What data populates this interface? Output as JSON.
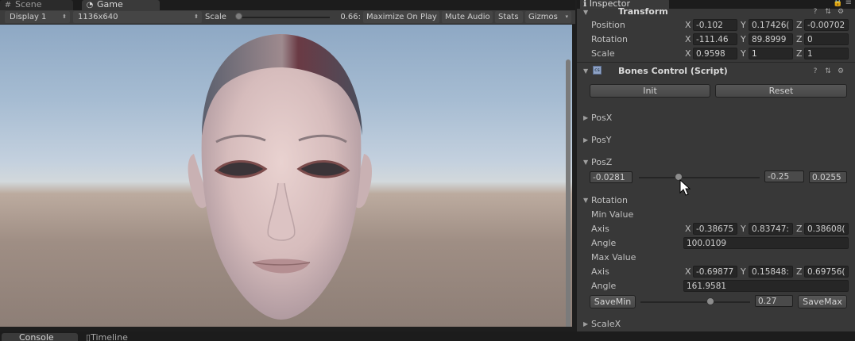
{
  "tabs": {
    "scene": "Scene",
    "game": "Game",
    "console": "Console",
    "timeline": "Timeline"
  },
  "game_toolbar": {
    "display": "Display 1",
    "resolution": "1136x640",
    "scale_label": "Scale",
    "scale_value": "0.66:",
    "maximize": "Maximize On Play",
    "mute": "Mute Audio",
    "stats": "Stats",
    "gizmos": "Gizmos"
  },
  "inspector": {
    "tab": "Inspector",
    "transform": {
      "title": "Transform",
      "position_label": "Position",
      "position": {
        "x": "-0.102",
        "y": "0.17426(",
        "z": "-0.00702"
      },
      "rotation_label": "Rotation",
      "rotation": {
        "x": "-111.46",
        "y": "89.8999",
        "z": "0"
      },
      "scale_label": "Scale",
      "scale": {
        "x": "0.9598",
        "y": "1",
        "z": "1"
      }
    },
    "axis_labels": {
      "x": "X",
      "y": "Y",
      "z": "Z"
    },
    "bones": {
      "title": "Bones Control (Script)",
      "init": "Init",
      "reset": "Reset",
      "posx": "PosX",
      "posy": "PosY",
      "posz": "PosZ",
      "posz_min": "-0.0281",
      "posz_value": "-0.25",
      "posz_max": "0.0255",
      "posz_slider_fraction": 0.33,
      "rotation": "Rotation",
      "min_value": "Min Value",
      "min_axis_label": "Axis",
      "min_axis": {
        "x": "-0.38675",
        "y": "0.83747:",
        "z": "0.38608("
      },
      "min_angle_label": "Angle",
      "min_angle": "100.0109",
      "max_value": "Max Value",
      "max_axis_label": "Axis",
      "max_axis": {
        "x": "-0.69877",
        "y": "0.15848:",
        "z": "0.69756("
      },
      "max_angle_label": "Angle",
      "max_angle": "161.9581",
      "save_min": "SaveMin",
      "rot_value": "0.27",
      "save_max": "SaveMax",
      "rot_slider_fraction": 0.64,
      "scalex": "ScaleX"
    }
  },
  "colors": {
    "sky_top": "#8ea8c4",
    "ground": "#8d7e76",
    "panel": "#383838",
    "field": "#262626"
  }
}
